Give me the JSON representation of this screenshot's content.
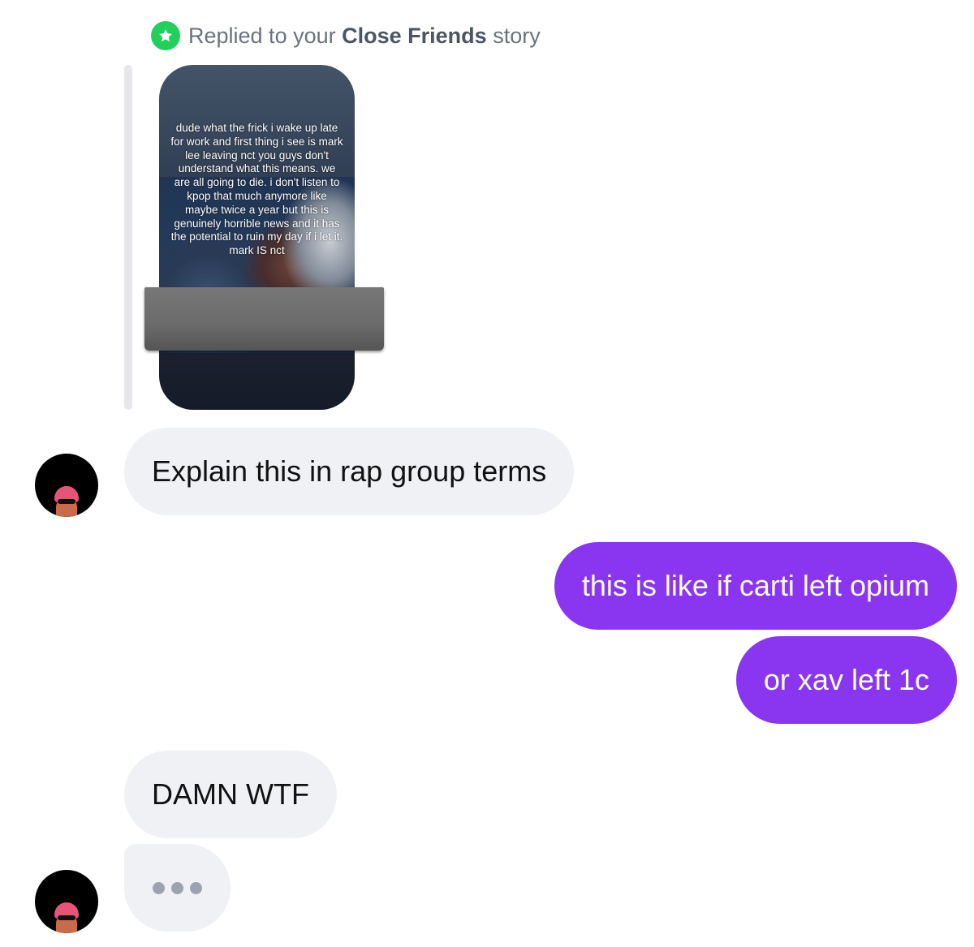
{
  "reply_header": {
    "prefix": "Replied to your",
    "bold": "Close Friends",
    "suffix": "story",
    "icon": "star-icon",
    "badge_color": "#1fd05a"
  },
  "story": {
    "caption": "dude what the frick i wake up late for work and first thing i see is mark lee leaving nct you guys don't understand what this means. we are all going to die. i don't listen to kpop that much anymore like maybe twice a year but this is genuinely horrible news and it has the potential to ruin my day if i let it. mark IS nct"
  },
  "messages": [
    {
      "sender": "them",
      "text": "Explain this in rap group terms"
    },
    {
      "sender": "me",
      "text": "this is like if carti left opium"
    },
    {
      "sender": "me",
      "text": "or xav left 1c"
    },
    {
      "sender": "them",
      "text": "DAMN WTF"
    }
  ],
  "typing_indicator": {
    "icon": "typing-dots-icon"
  },
  "colors": {
    "outgoing_bubble": "#8a35f0",
    "incoming_bubble": "#eff1f4"
  }
}
